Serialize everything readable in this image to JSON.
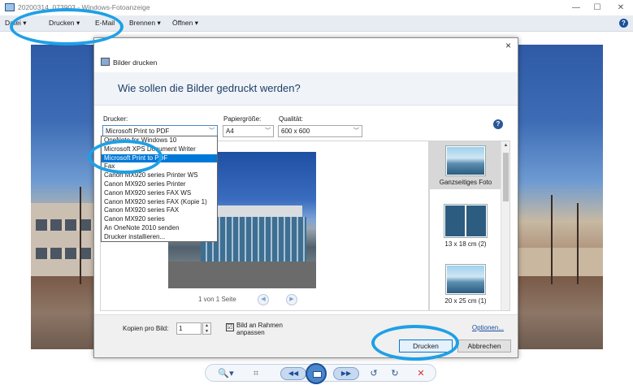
{
  "window": {
    "title": "20200314_073903 - Windows-Fotoanzeige",
    "minimize": "—",
    "maximize": "☐",
    "close": "✕"
  },
  "menu": {
    "items": [
      {
        "label": "Datei ▾"
      },
      {
        "label": "Drucken ▾"
      },
      {
        "label": "E-Mail"
      },
      {
        "label": "Brennen ▾"
      },
      {
        "label": "Öffnen ▾"
      }
    ],
    "help": "?"
  },
  "dialog": {
    "close": "×",
    "title": "Bilder drucken",
    "question": "Wie sollen die Bilder gedruckt werden?",
    "printer_label": "Drucker:",
    "printer_value": "Microsoft Print to PDF",
    "paper_label": "Papiergröße:",
    "paper_value": "A4",
    "quality_label": "Qualität:",
    "quality_value": "600 x 600",
    "help": "?",
    "page_info": "1 von 1 Seite",
    "prev": "◀",
    "next": "▶",
    "printer_options": [
      "OneNote for Windows 10",
      "Microsoft XPS Document Writer",
      "Microsoft Print to PDF",
      "Fax",
      "Canon MX920 series Printer WS",
      "Canon MX920 series Printer",
      "Canon MX920 series FAX WS",
      "Canon MX920 series FAX (Kopie 1)",
      "Canon MX920 series FAX",
      "Canon MX920 series",
      "An OneNote 2010 senden",
      "Drucker installieren..."
    ],
    "selected_printer_index": 2,
    "layouts": [
      {
        "label": "Ganzseitiges Foto"
      },
      {
        "label": "13 x 18 cm (2)"
      },
      {
        "label": "20 x 25 cm (1)"
      }
    ],
    "copies_label": "Kopien pro Bild:",
    "copies_value": "1",
    "fit_label": "Bild an Rahmen anpassen",
    "fit_checked": "☑",
    "options_link": "Optionen...",
    "print_button": "Drucken",
    "cancel_button": "Abbrechen"
  },
  "toolbar": {
    "zoom": "🔍▾",
    "fit": "⌗",
    "prev": "◀◀",
    "next": "▶▶",
    "rotate_ccw": "↺",
    "rotate_cw": "↻",
    "delete": "✕"
  },
  "colors": {
    "annotation": "#1ea0e6",
    "selection": "#0078d7",
    "menubar": "#e7ecf3"
  }
}
